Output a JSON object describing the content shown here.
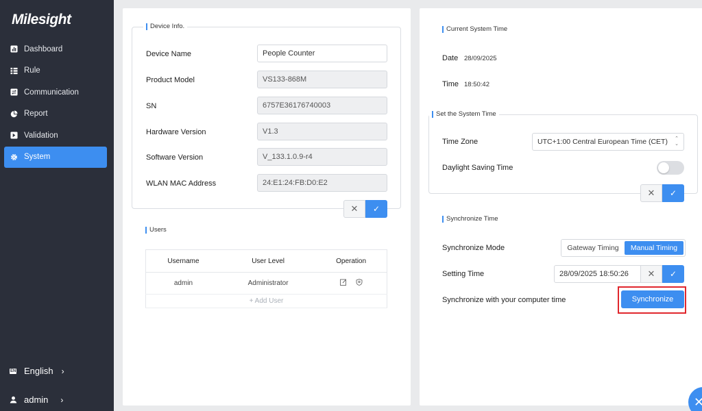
{
  "brand": {
    "logo_text": "Milesight",
    "accent": "#3d8ef0",
    "sidebar_bg": "#2b2f3a"
  },
  "sidebar": {
    "items": [
      {
        "label": "Dashboard",
        "icon": "bar-chart-icon"
      },
      {
        "label": "Rule",
        "icon": "list-icon"
      },
      {
        "label": "Communication",
        "icon": "exchange-icon"
      },
      {
        "label": "Report",
        "icon": "pie-chart-icon"
      },
      {
        "label": "Validation",
        "icon": "validation-icon"
      },
      {
        "label": "System",
        "icon": "gear-icon",
        "active": true
      }
    ],
    "language": {
      "label": "English",
      "icon_text": "EN"
    },
    "user": {
      "label": "admin",
      "icon": "user-icon"
    }
  },
  "device_info": {
    "legend": "Device Info.",
    "fields": [
      {
        "label": "Device Name",
        "value": "People Counter",
        "editable": true
      },
      {
        "label": "Product Model",
        "value": "VS133-868M",
        "editable": false
      },
      {
        "label": "SN",
        "value": "6757E36176740003",
        "editable": false
      },
      {
        "label": "Hardware Version",
        "value": "V1.3",
        "editable": false
      },
      {
        "label": "Software Version",
        "value": "V_133.1.0.9-r4",
        "editable": false
      },
      {
        "label": "WLAN MAC Address",
        "value": "24:E1:24:FB:D0:E2",
        "editable": false
      }
    ]
  },
  "users": {
    "title": "Users",
    "columns": [
      "Username",
      "User Level",
      "Operation"
    ],
    "rows": [
      {
        "username": "admin",
        "level": "Administrator"
      }
    ],
    "add_label": "+ Add User"
  },
  "current_time": {
    "title": "Current System Time",
    "date_label": "Date",
    "date_value": "28/09/2025",
    "time_label": "Time",
    "time_value": "18:50:42"
  },
  "set_time": {
    "legend": "Set the System Time",
    "timezone_label": "Time Zone",
    "timezone_value": "UTC+1:00 Central European Time (CET)",
    "dst_label": "Daylight Saving Time",
    "dst_enabled": false
  },
  "sync": {
    "title": "Synchronize Time",
    "mode_label": "Synchronize Mode",
    "mode_options": [
      "Gateway Timing",
      "Manual Timing"
    ],
    "mode_selected": "Manual Timing",
    "setting_label": "Setting Time",
    "setting_value": "28/09/2025 18:50:26",
    "computer_label": "Synchronize with your computer time",
    "sync_button": "Synchronize"
  },
  "icons": {
    "cancel": "✕",
    "confirm": "✓",
    "chevron": "›"
  }
}
